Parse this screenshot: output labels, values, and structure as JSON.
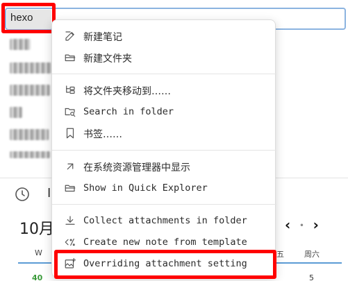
{
  "rename": {
    "value": "hexo"
  },
  "bottom_panel": {
    "label": "I"
  },
  "calendar": {
    "month": "10月",
    "nav": {
      "prev": "‹",
      "dot": "•",
      "next": "›"
    },
    "week_header": "W",
    "weekday_fri": "五",
    "weekday_sat": "周六",
    "week_number": "40",
    "day_number": "5"
  },
  "menu": {
    "new_note": "新建笔记",
    "new_folder": "新建文件夹",
    "move_folder": "将文件夹移动到……",
    "search_in_folder": "Search in folder",
    "bookmark": "书签……",
    "show_in_system": "在系统资源管理器中显示",
    "show_quick_explorer": "Show in Quick Explorer",
    "collect_attachments": "Collect attachments in folder",
    "create_from_template": "Create new note from template",
    "overriding_attachment": "Overriding attachment setting"
  }
}
